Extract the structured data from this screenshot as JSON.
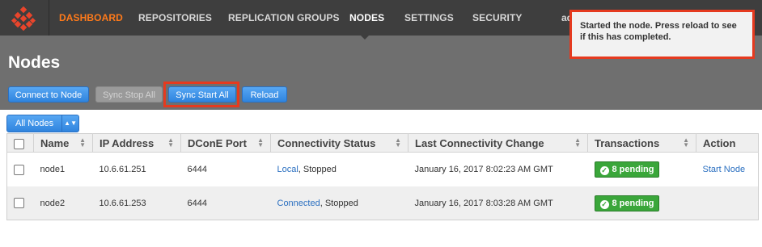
{
  "nav": {
    "items": [
      "DASHBOARD",
      "REPOSITORIES",
      "REPLICATION GROUPS",
      "NODES",
      "SETTINGS",
      "SECURITY"
    ],
    "user_fragment": "ad"
  },
  "colors": {
    "accent": "#ff7a1a",
    "primary": "#2f84de",
    "success": "#3aa63a",
    "highlight": "#e53a1f"
  },
  "toast": {
    "message": "Started the node. Press reload to see if this has completed."
  },
  "page": {
    "title": "Nodes"
  },
  "toolbar": {
    "connect": "Connect to Node",
    "sync_stop_all": "Sync Stop All",
    "sync_start_all": "Sync Start All",
    "reload": "Reload"
  },
  "filter": {
    "selected": "All Nodes"
  },
  "table": {
    "headers": [
      "Name",
      "IP Address",
      "DConE Port",
      "Connectivity Status",
      "Last Connectivity Change",
      "Transactions",
      "Action"
    ],
    "rows": [
      {
        "name": "node1",
        "ip": "10.6.61.251",
        "port": "6444",
        "status_link": "Local",
        "status_rest": ", Stopped",
        "last_change": "January 16, 2017 8:02:23 AM GMT",
        "transactions": "8 pending",
        "action": "Start Node"
      },
      {
        "name": "node2",
        "ip": "10.6.61.253",
        "port": "6444",
        "status_link": "Connected",
        "status_rest": ", Stopped",
        "last_change": "January 16, 2017 8:03:28 AM GMT",
        "transactions": "8 pending",
        "action": ""
      }
    ]
  }
}
